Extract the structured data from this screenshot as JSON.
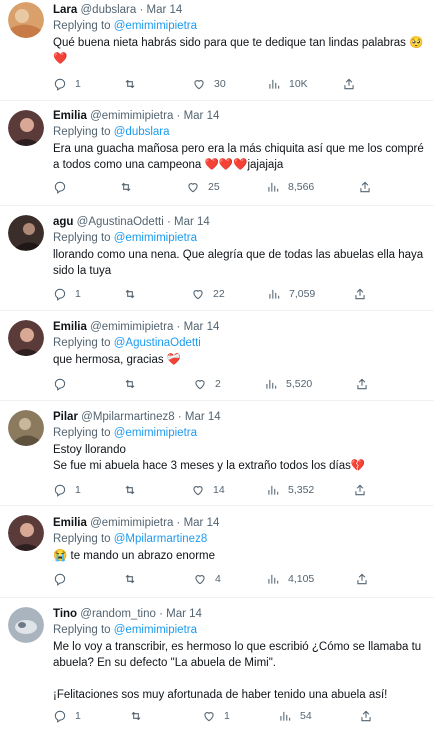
{
  "replying_label": "Replying to",
  "separator": " · ",
  "tweets": [
    {
      "name": "Lara",
      "handle": "@dubslara",
      "date": "Mar 14",
      "replying_to": "@emimimipietra",
      "text": "Qué buena nieta habrás sido para que te dedique tan lindas palabras 🥺\n❤️",
      "replies": "1",
      "retweets": "",
      "likes": "30",
      "views": "10K",
      "avatar_color": "#d9a06b"
    },
    {
      "name": "Emilia",
      "handle": "@emimimipietra",
      "date": "Mar 14",
      "replying_to": "@dubslara",
      "text": "Era una guacha mañosa pero era la más chiquita así que me los compré a todos como una campeona ❤️❤️❤️jajajaja",
      "replies": "",
      "retweets": "",
      "likes": "25",
      "views": "8,566",
      "avatar_color": "#5a3b3a"
    },
    {
      "name": "agu",
      "handle": "@AgustinaOdetti",
      "date": "Mar 14",
      "replying_to": "@emimimipietra",
      "text": "llorando como una nena. Que alegría que de todas las abuelas ella haya sido la tuya",
      "replies": "1",
      "retweets": "",
      "likes": "22",
      "views": "7,059",
      "avatar_color": "#3b2e2a"
    },
    {
      "name": "Emilia",
      "handle": "@emimimipietra",
      "date": "Mar 14",
      "replying_to": "@AgustinaOdetti",
      "text": "que hermosa, gracias ❤️‍🩹",
      "replies": "",
      "retweets": "",
      "likes": "2",
      "views": "5,520",
      "avatar_color": "#5a3b3a"
    },
    {
      "name": "Pilar",
      "handle": "@Mpilarmartinez8",
      "date": "Mar 14",
      "replying_to": "@emimimipietra",
      "text": "Estoy llorando\nSe fue mi abuela hace 3 meses y la extraño todos los días💔",
      "replies": "1",
      "retweets": "",
      "likes": "14",
      "views": "5,352",
      "avatar_color": "#8c7a5e"
    },
    {
      "name": "Emilia",
      "handle": "@emimimipietra",
      "date": "Mar 14",
      "replying_to": "@Mpilarmartinez8",
      "text": "😭 te mando un abrazo enorme",
      "replies": "",
      "retweets": "",
      "likes": "4",
      "views": "4,105",
      "avatar_color": "#5a3b3a"
    },
    {
      "name": "Tino",
      "handle": "@random_tino",
      "date": "Mar 14",
      "replying_to": "@emimimipietra",
      "text": "Me lo voy a transcribir, es hermoso lo que escribió ¿Cómo se llamaba tu abuela? En su defecto \"La abuela de Mimi\".\n\n¡Felitaciones sos muy afortunada de haber tenido una abuela así!",
      "replies": "1",
      "retweets": "",
      "likes": "1",
      "views": "54",
      "avatar_color": "#aab4bf"
    }
  ]
}
